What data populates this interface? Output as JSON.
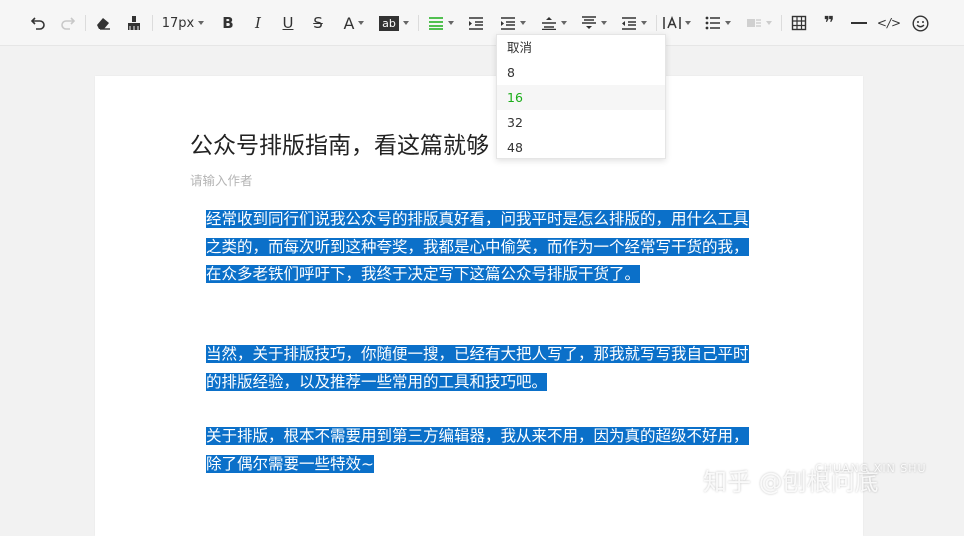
{
  "toolbar": {
    "font_size_value": "17px",
    "bold_glyph": "B",
    "italic_glyph": "I",
    "underline_glyph": "U",
    "strike_glyph": "S",
    "font_color_glyph": "A",
    "bg_color_glyph": "ab",
    "quote_glyph": "❞",
    "code_glyph": "</>",
    "accent_color": "#1aad19",
    "icons": [
      "undo-icon",
      "redo-icon",
      "clear-format-icon",
      "format-painter-icon",
      "align-icon",
      "indent-icon",
      "line-height-icon",
      "paragraph-spacing-icon",
      "letter-spacing-icon",
      "list-icon",
      "table-icon",
      "quote-icon",
      "divider-icon",
      "code-icon",
      "emoji-icon"
    ]
  },
  "dropdown": {
    "items": [
      "取消",
      "8",
      "16",
      "32",
      "48"
    ],
    "selected": "16"
  },
  "article": {
    "title": "公众号排版指南，看这篇就够",
    "author_placeholder": "请输入作者",
    "paragraphs": [
      "经常收到同行们说我公众号的排版真好看，问我平时是怎么排版的，用什么工具之类的，而每次听到这种夸奖，我都是心中偷笑，而作为一个经常写干货的我，在众多老铁们呼吁下，我终于决定写下这篇公众号排版干货了。",
      "当然，关于排版技巧，你随便一搜，已经有大把人写了，那我就写写我自己平时的排版经验，以及推荐一些常用的工具和技巧吧。",
      "关于排版，根本不需要用到第三方编辑器，我从来不用，因为真的超级不好用，除了偶尔需要一些特效~"
    ],
    "selection_color": "#0b70c9"
  },
  "watermark": {
    "text": "知乎 @刨根问底",
    "sub": "CHUANG XIN SHU"
  }
}
